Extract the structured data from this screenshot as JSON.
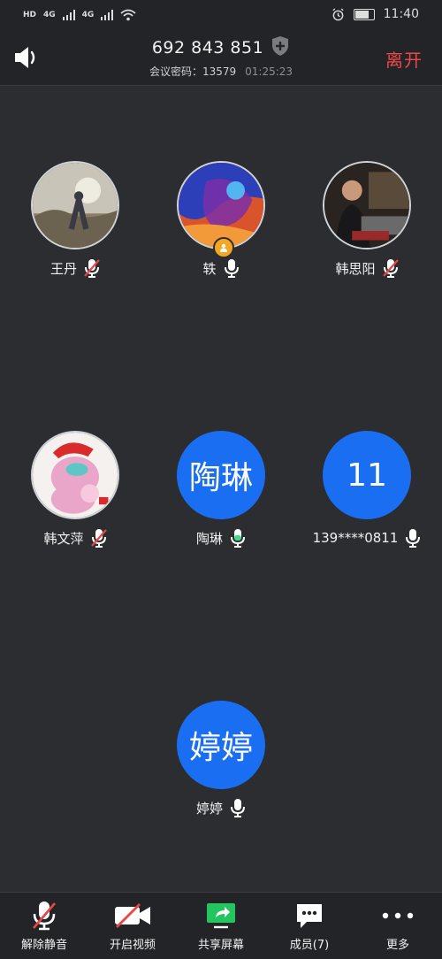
{
  "status_bar": {
    "hd_tag": "HD",
    "net1": "4G",
    "net2": "4G",
    "time": "11:40"
  },
  "header": {
    "meeting_id": "692 843 851",
    "password_label": "会议密码：13579",
    "timer": "01:25:23",
    "leave_label": "离开"
  },
  "participants": [
    {
      "name": "王丹",
      "avatar_type": "photo",
      "mic": "muted"
    },
    {
      "name": "轶",
      "avatar_type": "photo",
      "mic": "on",
      "host": true
    },
    {
      "name": "韩思阳",
      "avatar_type": "photo",
      "mic": "muted"
    },
    {
      "name": "韩文萍",
      "avatar_type": "photo",
      "mic": "muted"
    },
    {
      "name": "陶琳",
      "avatar_type": "text",
      "avatar_text": "陶琳",
      "mic": "speaking"
    },
    {
      "name": "139****0811",
      "avatar_type": "text",
      "avatar_text": "11",
      "mic": "on"
    },
    {
      "name": "婷婷",
      "avatar_type": "text",
      "avatar_text": "婷婷",
      "mic": "on"
    }
  ],
  "toolbar": {
    "unmute": "解除静音",
    "start_video": "开启视频",
    "share_screen": "共享屏幕",
    "members": "成员(7)",
    "more": "更多"
  },
  "colors": {
    "background": "#2b2d30",
    "bar": "#232428",
    "accent_blue": "#1a6ef2",
    "leave_red": "#f04848",
    "muted_red": "#e84545",
    "speaking_green": "#3ddc84",
    "share_green": "#22c55e"
  }
}
